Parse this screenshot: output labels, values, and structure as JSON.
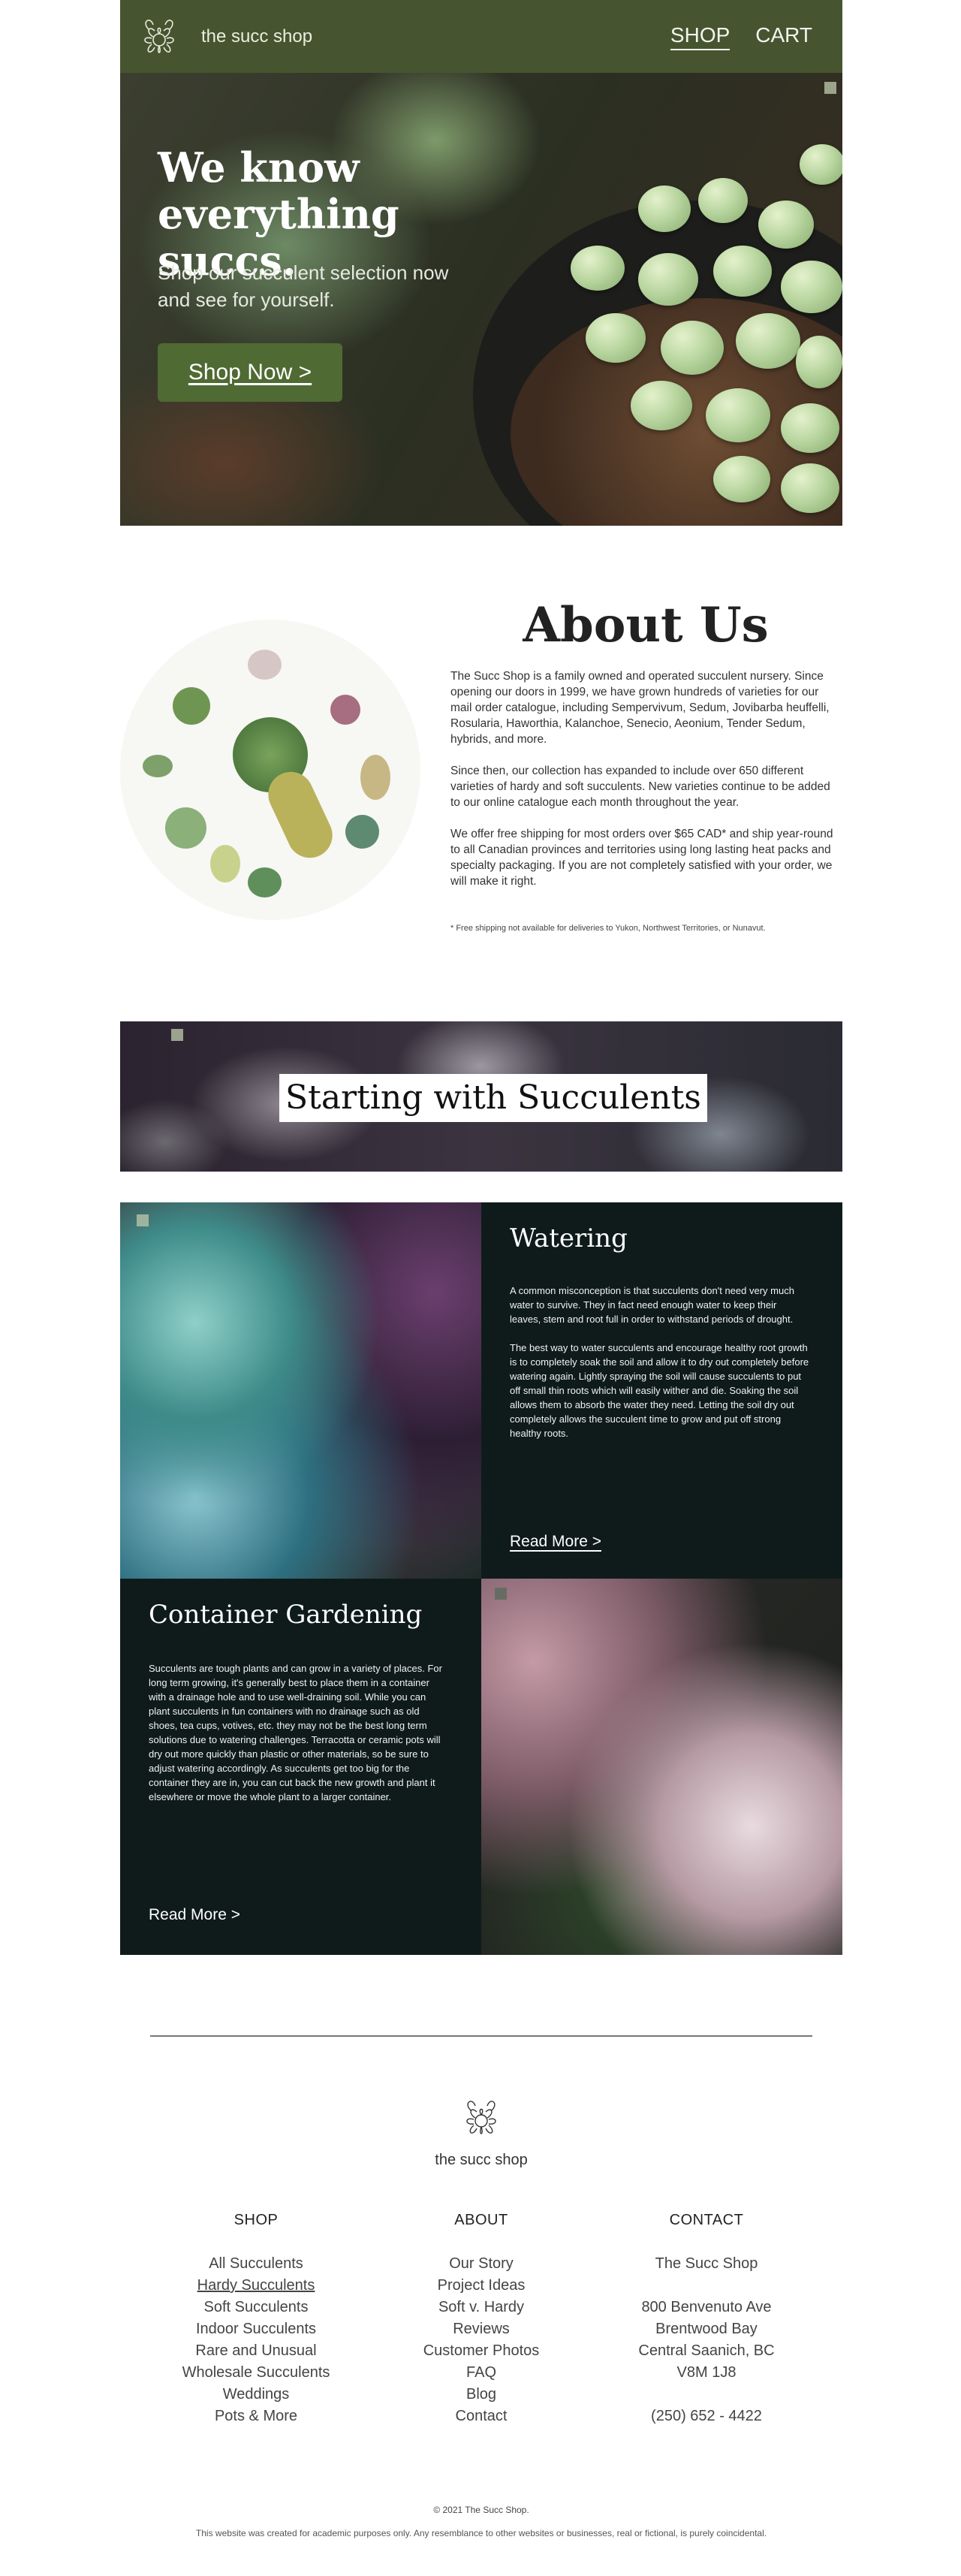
{
  "header": {
    "brand": "the succ shop",
    "nav": [
      {
        "label": "SHOP"
      },
      {
        "label": "CART"
      }
    ]
  },
  "hero": {
    "title": "We know everything succs.",
    "subtitle": "Shop our succulent selection now and see for yourself.",
    "cta": "Shop Now  >"
  },
  "about": {
    "title": "About Us",
    "paragraphs": [
      "The Succ Shop is a family owned and operated succulent nursery. Since opening our doors in 1999, we have grown hundreds of varieties for our mail order catalogue, including Sempervivum, Sedum, Jovibarba heuffelli, Rosularia, Haworthia, Kalanchoe, Senecio, Aeonium, Tender Sedum, hybrids, and more.",
      "Since then, our collection has expanded to include over 650 different varieties of hardy and soft succulents. New varieties continue to be added to our online catalogue each month throughout the year.",
      "We offer free shipping for most orders over $65 CAD* and ship year-round to all Canadian provinces and territories using long lasting heat packs and specialty packaging. If you are not completely satisfied with your order, we will make it right."
    ],
    "note": "* Free shipping not available for deliveries to Yukon, Northwest Territories, or Nunavut."
  },
  "banner": {
    "title": "Starting with Succulents"
  },
  "watering": {
    "title": "Watering",
    "paragraphs": [
      "A common misconception is that succulents don't need very much water to survive. They in fact need enough water to keep their leaves, stem and root full in order to withstand periods of drought.",
      "The best way to water succulents and encourage healthy root growth is to completely soak the soil and allow it to dry out completely before watering again. Lightly spraying the soil will cause succulents to put off small thin roots which will easily wither and die. Soaking the soil allows them to absorb the water they need. Letting the soil dry out completely allows the succulent time to grow and put off strong healthy roots."
    ],
    "read_more": "Read More  >"
  },
  "container": {
    "title": "Container Gardening",
    "paragraphs": [
      "Succulents are tough plants and can grow in a variety of places. For long term growing, it's generally best to place them in a container with a drainage hole and to use well-draining soil. While you can plant succulents in fun containers with no drainage such as old shoes, tea cups, votives, etc. they may not be the best long term solutions due to watering challenges. Terracotta or ceramic pots will dry out more quickly than plastic or other materials, so be sure to adjust watering accordingly. As succulents get too big for the container they are in, you can cut back the new growth and plant it elsewhere or move the whole plant to a larger container."
    ],
    "read_more": "Read More  >"
  },
  "footer": {
    "brand": "the succ shop",
    "shop": {
      "heading": "SHOP",
      "items": [
        "All Succulents",
        "Hardy Succulents",
        "Soft Succulents",
        "Indoor Succulents",
        "Rare and Unusual",
        "Wholesale Succulents",
        "Weddings",
        "Pots & More"
      ]
    },
    "about": {
      "heading": "ABOUT",
      "items": [
        "Our Story",
        "Project Ideas",
        "Soft v. Hardy",
        "Reviews",
        "Customer Photos",
        "FAQ",
        "Blog",
        "Contact"
      ]
    },
    "contact": {
      "heading": "CONTACT",
      "name": "The Succ Shop",
      "address": [
        "800 Benvenuto Ave",
        "Brentwood Bay",
        "Central Saanich, BC",
        "V8M 1J8"
      ],
      "phone": "(250) 652 - 4422"
    },
    "copyright": "© 2021 The Succ Shop.",
    "disclaimer": "This website was created for academic purposes only. Any resemblance to other websites or businesses, real or fictional, is purely coincidental."
  }
}
